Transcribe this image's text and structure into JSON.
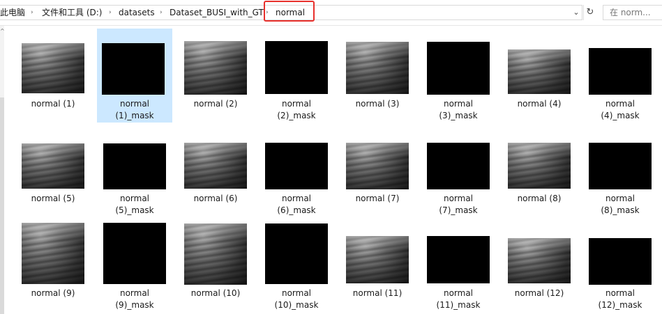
{
  "breadcrumb": {
    "items": [
      "此电脑",
      "文件和工具 (D:)",
      "datasets",
      "Dataset_BUSI_with_GT",
      "normal"
    ],
    "separator": "›"
  },
  "search": {
    "placeholder": "在 norm..."
  },
  "icons": {
    "dropdown": "chevron-down-icon",
    "refresh": "refresh-icon",
    "nav_up": "chevron-up-icon"
  },
  "colors": {
    "selected": "#cce8ff",
    "highlight_box": "#e8302c"
  },
  "files": [
    {
      "line1": "normal (1)",
      "line2": "",
      "kind": "image"
    },
    {
      "line1": "normal",
      "line2": "(1)_mask",
      "kind": "mask"
    },
    {
      "line1": "normal (2)",
      "line2": "",
      "kind": "image"
    },
    {
      "line1": "normal",
      "line2": "(2)_mask",
      "kind": "mask"
    },
    {
      "line1": "normal (3)",
      "line2": "",
      "kind": "image"
    },
    {
      "line1": "normal",
      "line2": "(3)_mask",
      "kind": "mask"
    },
    {
      "line1": "normal (4)",
      "line2": "",
      "kind": "image"
    },
    {
      "line1": "normal",
      "line2": "(4)_mask",
      "kind": "mask"
    },
    {
      "line1": "normal (5)",
      "line2": "",
      "kind": "image"
    },
    {
      "line1": "normal",
      "line2": "(5)_mask",
      "kind": "mask"
    },
    {
      "line1": "normal (6)",
      "line2": "",
      "kind": "image"
    },
    {
      "line1": "normal",
      "line2": "(6)_mask",
      "kind": "mask"
    },
    {
      "line1": "normal (7)",
      "line2": "",
      "kind": "image"
    },
    {
      "line1": "normal",
      "line2": "(7)_mask",
      "kind": "mask"
    },
    {
      "line1": "normal (8)",
      "line2": "",
      "kind": "image"
    },
    {
      "line1": "normal",
      "line2": "(8)_mask",
      "kind": "mask"
    },
    {
      "line1": "normal (9)",
      "line2": "",
      "kind": "image"
    },
    {
      "line1": "normal",
      "line2": "(9)_mask",
      "kind": "mask"
    },
    {
      "line1": "normal (10)",
      "line2": "",
      "kind": "image"
    },
    {
      "line1": "normal",
      "line2": "(10)_mask",
      "kind": "mask"
    },
    {
      "line1": "normal (11)",
      "line2": "",
      "kind": "image"
    },
    {
      "line1": "normal",
      "line2": "(11)_mask",
      "kind": "mask"
    },
    {
      "line1": "normal (12)",
      "line2": "",
      "kind": "image"
    },
    {
      "line1": "normal",
      "line2": "(12)_mask",
      "kind": "mask"
    }
  ]
}
